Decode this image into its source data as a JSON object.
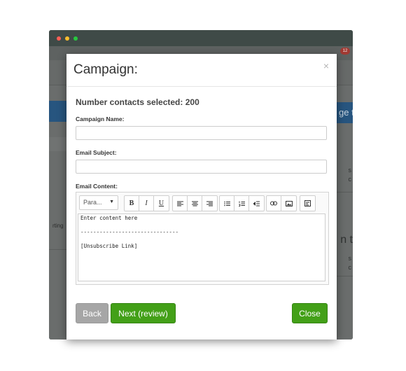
{
  "background": {
    "badge": "12",
    "right_banner_text": "ge t",
    "left_side_text": "rting",
    "right_texts": [
      "s",
      "c",
      "n t",
      "s",
      "c"
    ]
  },
  "modal": {
    "title": "Campaign:",
    "close_symbol": "×",
    "contacts_text": "Number contacts selected: 200",
    "campaign_name": {
      "label": "Campaign Name:",
      "value": ""
    },
    "email_subject": {
      "label": "Email Subject:",
      "value": ""
    },
    "email_content": {
      "label": "Email Content:",
      "format_select": "Para...",
      "lines": [
        "Enter content here",
        "-------------------------------",
        "[Unsubscribe Link]"
      ]
    },
    "buttons": {
      "back": "Back",
      "next": "Next (review)",
      "close": "Close"
    }
  },
  "colors": {
    "primary_green": "#43a018",
    "back_gray": "#a6a6a6",
    "banner_blue": "#27557f"
  }
}
